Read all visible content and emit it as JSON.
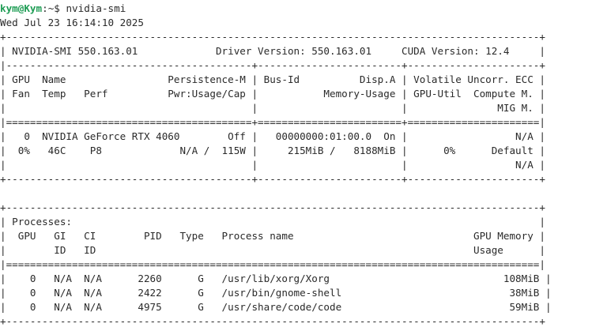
{
  "prompt": {
    "user": "kym",
    "at": "@",
    "host": "Kym",
    "sep": ":",
    "path": "~",
    "symbol": "$ ",
    "command": "nvidia-smi"
  },
  "colors": {
    "prompt_user_host": "#1f9d55",
    "text": "#2a2a2a",
    "background": "#ffffff"
  },
  "output_lines": [
    "Wed Jul 23 16:14:10 2025",
    "+-----------------------------------------------------------------------------------------+",
    "| NVIDIA-SMI 550.163.01             Driver Version: 550.163.01     CUDA Version: 12.4     |",
    "|-----------------------------------------+------------------------+----------------------+",
    "| GPU  Name                 Persistence-M | Bus-Id          Disp.A | Volatile Uncorr. ECC |",
    "| Fan  Temp   Perf          Pwr:Usage/Cap |           Memory-Usage | GPU-Util  Compute M. |",
    "|                                         |                        |               MIG M. |",
    "|=========================================+========================+======================|",
    "|   0  NVIDIA GeForce RTX 4060        Off |   00000000:01:00.0  On |                  N/A |",
    "|  0%   46C    P8             N/A /  115W |     215MiB /   8188MiB |      0%      Default |",
    "|                                         |                        |                  N/A |",
    "+-----------------------------------------+------------------------+----------------------+",
    "",
    "+-----------------------------------------------------------------------------------------+",
    "| Processes:                                                                              |",
    "|  GPU   GI   CI        PID   Type   Process name                              GPU Memory |",
    "|        ID   ID                                                               Usage      |",
    "|=========================================================================================|",
    "|    0   N/A  N/A      2260      G   /usr/lib/xorg/Xorg                             108MiB |",
    "|    0   N/A  N/A      2422      G   /usr/bin/gnome-shell                            38MiB |",
    "|    0   N/A  N/A      4975      G   /usr/share/code/code                            59MiB |",
    "+-----------------------------------------------------------------------------------------+"
  ]
}
